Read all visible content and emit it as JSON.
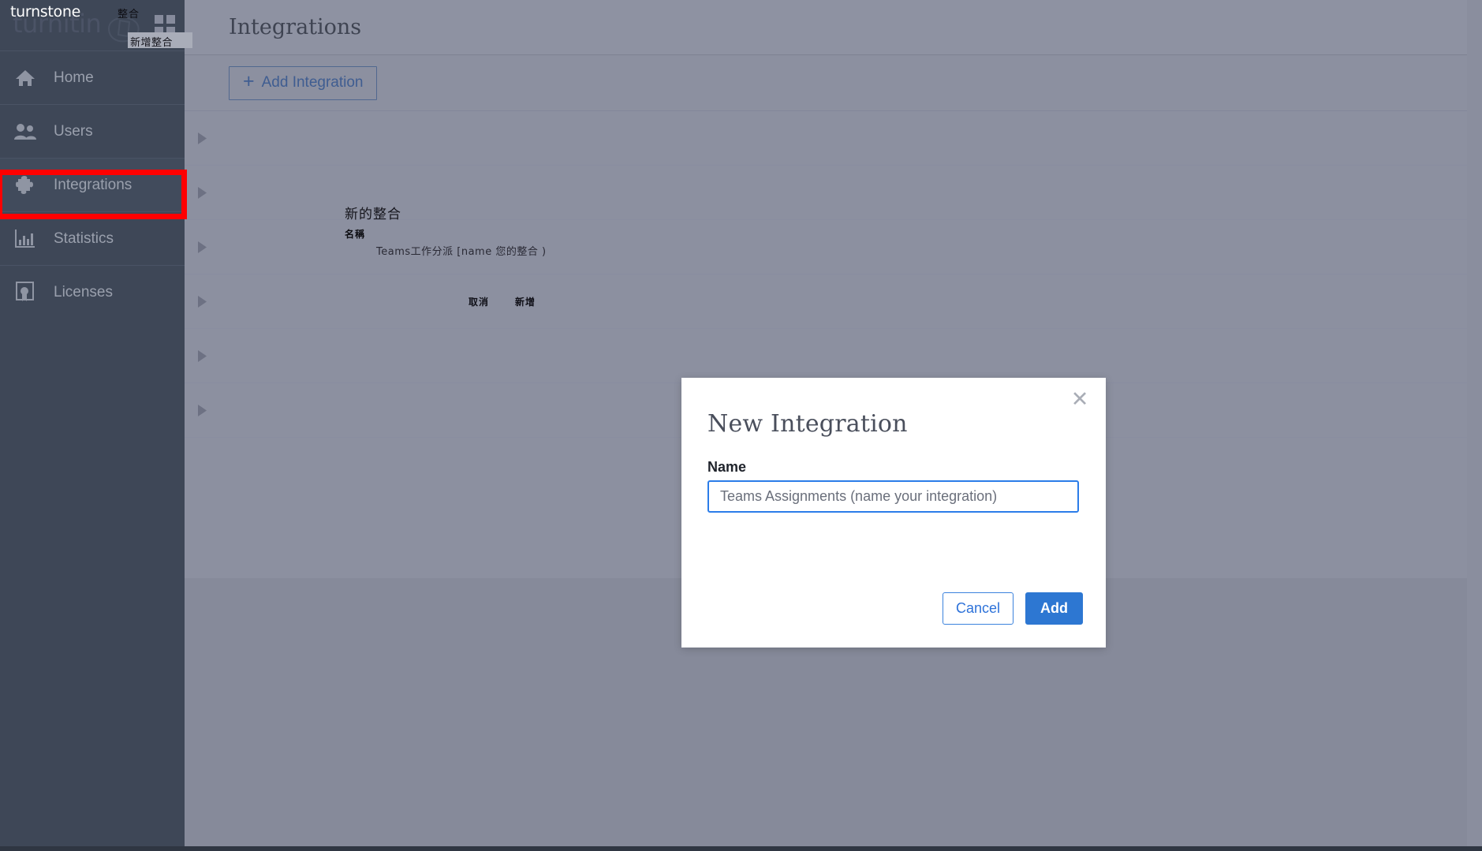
{
  "brand": {
    "logo_text": "turnitin",
    "overlay_name": "turnstone",
    "logo_mark_icon": "turnitin-swirl-icon"
  },
  "header_overlay": {
    "cn_label": "整合",
    "grid_icon": "windows-grid-icon",
    "toast_text": "新增整合"
  },
  "sidebar": {
    "items": [
      {
        "label": "Home",
        "icon": "home-icon",
        "active": false
      },
      {
        "label": "Users",
        "icon": "users-icon",
        "active": false
      },
      {
        "label": "Integrations",
        "icon": "puzzle-piece-icon",
        "active": true
      },
      {
        "label": "Statistics",
        "icon": "bar-chart-icon",
        "active": false
      },
      {
        "label": "Licenses",
        "icon": "certificate-icon",
        "active": false
      }
    ],
    "highlight_color": "#ff0000",
    "highlighted_item": "Integrations"
  },
  "page": {
    "title": "Integrations"
  },
  "toolbar": {
    "add_integration_label": "Add Integration",
    "plus_glyph": "+"
  },
  "integration_rows": [
    {
      "caret": "caret-right-icon"
    },
    {
      "caret": "caret-right-icon"
    },
    {
      "caret": "caret-right-icon"
    },
    {
      "caret": "caret-right-icon"
    },
    {
      "caret": "caret-right-icon"
    },
    {
      "caret": "caret-right-icon"
    }
  ],
  "cn_ghost": {
    "title": "新的整合",
    "name_label": "名稱",
    "name_value": "Teams工作分派 [name 您的整合 )",
    "cancel": "取消",
    "add": "新增"
  },
  "modal": {
    "title": "New Integration",
    "close_glyph": "✕",
    "close_icon": "close-icon",
    "name_label": "Name",
    "name_value": "Teams Assignments (name your integration)",
    "name_placeholder": "Teams Assignments (name your integration)",
    "cancel_label": "Cancel",
    "add_label": "Add"
  },
  "colors": {
    "sidebar_bg": "#3e4757",
    "content_bg": "#8c90a0",
    "accent_blue": "#2d77d2",
    "link_blue": "#2d72d9",
    "highlight_red": "#ff0000"
  }
}
